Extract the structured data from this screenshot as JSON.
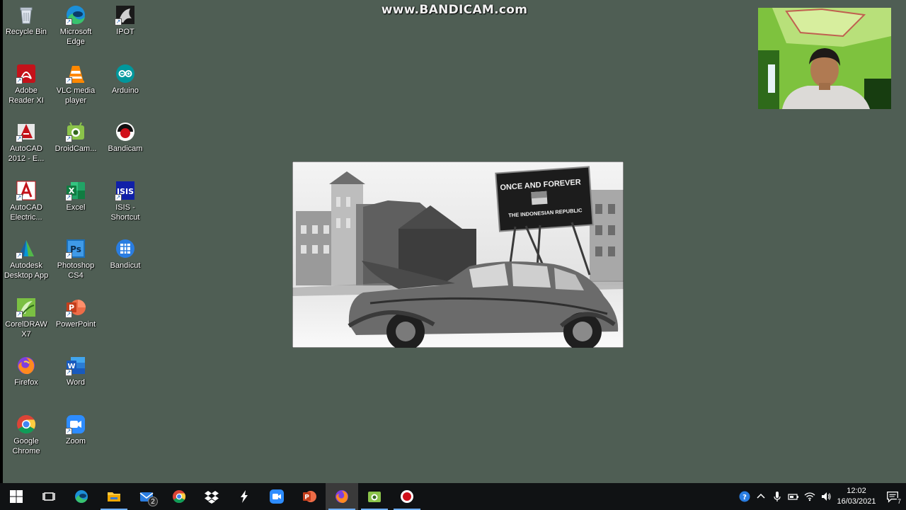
{
  "watermark": "www.BANDICAM.com",
  "desktop_icons": [
    {
      "label": "Recycle Bin",
      "icon": "recycle-bin-icon"
    },
    {
      "label": "Microsoft Edge",
      "icon": "edge-icon"
    },
    {
      "label": "IPOT",
      "icon": "ipot-icon"
    },
    {
      "label": "Adobe Reader XI",
      "icon": "adobe-reader-icon"
    },
    {
      "label": "VLC media player",
      "icon": "vlc-icon"
    },
    {
      "label": "Arduino",
      "icon": "arduino-icon"
    },
    {
      "label": "AutoCAD 2012 - E...",
      "icon": "autocad-icon"
    },
    {
      "label": "DroidCam...",
      "icon": "droidcam-icon"
    },
    {
      "label": "Bandicam",
      "icon": "bandicam-icon"
    },
    {
      "label": "AutoCAD Electric...",
      "icon": "autocad-electrical-icon"
    },
    {
      "label": "Excel",
      "icon": "excel-icon"
    },
    {
      "label": "ISIS - Shortcut",
      "icon": "isis-icon"
    },
    {
      "label": "Autodesk Desktop App",
      "icon": "autodesk-icon"
    },
    {
      "label": "Photoshop CS4",
      "icon": "photoshop-icon"
    },
    {
      "label": "Bandicut",
      "icon": "bandicut-icon"
    },
    {
      "label": "CorelDRAW X7",
      "icon": "coreldraw-icon"
    },
    {
      "label": "PowerPoint",
      "icon": "powerpoint-icon"
    },
    {
      "label": "Firefox",
      "icon": "firefox-icon"
    },
    {
      "label": "Word",
      "icon": "word-icon"
    },
    {
      "label": "Google Chrome",
      "icon": "chrome-icon"
    },
    {
      "label": "Zoom",
      "icon": "zoom-icon"
    }
  ],
  "photo": {
    "billboard_line1": "ONCE AND FOREVER",
    "billboard_line2": "THE INDONESIAN REPUBLIC"
  },
  "taskbar": {
    "mail_badge": "2",
    "clock_time": "12:02",
    "clock_date": "16/03/2021"
  },
  "colors": {
    "desktop_bg": "#4f5e54",
    "taskbar_bg": "#101214",
    "accent": "#6fb0ff"
  }
}
